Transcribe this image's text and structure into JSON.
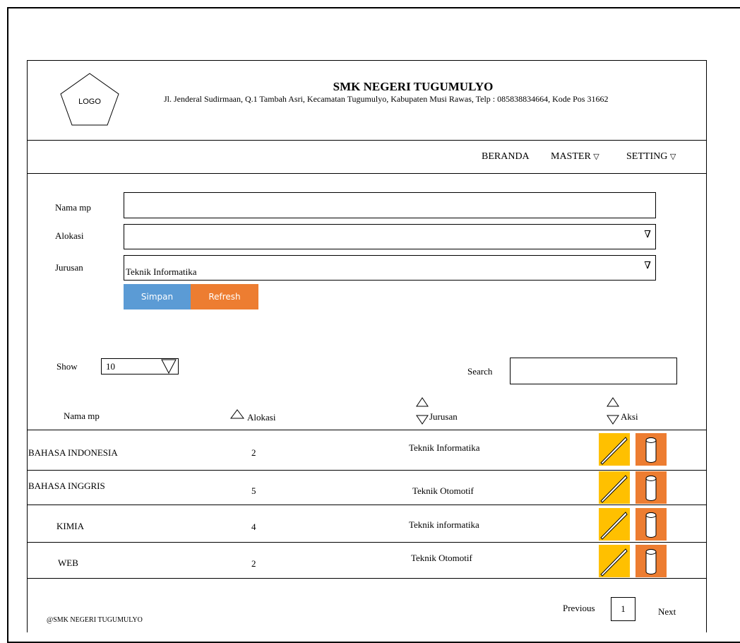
{
  "header": {
    "logo_text": "LOGO",
    "school_name": "SMK NEGERI TUGUMULYO",
    "address": "Jl. Jenderal Sudirmaan, Q.1 Tambah Asri, Kecamatan Tugumulyo, Kabupaten Musi Rawas, Telp : 085838834664, Kode Pos 31662"
  },
  "nav": {
    "items": [
      {
        "label": "BERANDA",
        "has_dropdown": false
      },
      {
        "label": "MASTER",
        "has_dropdown": true
      },
      {
        "label": "SETTING",
        "has_dropdown": true
      }
    ],
    "dropdown_glyph": "∇"
  },
  "form": {
    "nama_mp_label": "Nama mp",
    "nama_mp_value": "",
    "alokasi_label": "Alokasi",
    "alokasi_value": "",
    "jurusan_label": "Jurusan",
    "jurusan_value": "Teknik Informatika",
    "save_label": "Simpan",
    "refresh_label": "Refresh"
  },
  "table_controls": {
    "show_label": "Show",
    "show_value": "10",
    "search_label": "Search",
    "search_value": ""
  },
  "table": {
    "columns": [
      "Nama mp",
      "Alokasi",
      "Jurusan",
      "Aksi"
    ],
    "rows": [
      {
        "nama_mp": "BAHASA INDONESIA",
        "alokasi": "2",
        "jurusan": "Teknik Informatika"
      },
      {
        "nama_mp": "BAHASA INGGRIS",
        "alokasi": "5",
        "jurusan": "Teknik Otomotif"
      },
      {
        "nama_mp": "KIMIA",
        "alokasi": "4",
        "jurusan": "Teknik informatika"
      },
      {
        "nama_mp": "WEB",
        "alokasi": "2",
        "jurusan": "Teknik Otomotif"
      }
    ]
  },
  "pagination": {
    "previous_label": "Previous",
    "current_page": "1",
    "next_label": "Next"
  },
  "footer": {
    "copyright": "@SMK NEGERI TUGUMULYO"
  },
  "colors": {
    "save_button": "#5b9bd5",
    "refresh_button": "#ed7d31",
    "edit_action": "#ffc000",
    "delete_action": "#ed7d31"
  },
  "icons": {
    "edit": "pencil-icon",
    "delete": "trash-icon",
    "sort_asc": "sort-up-icon",
    "sort_desc": "sort-down-icon"
  }
}
